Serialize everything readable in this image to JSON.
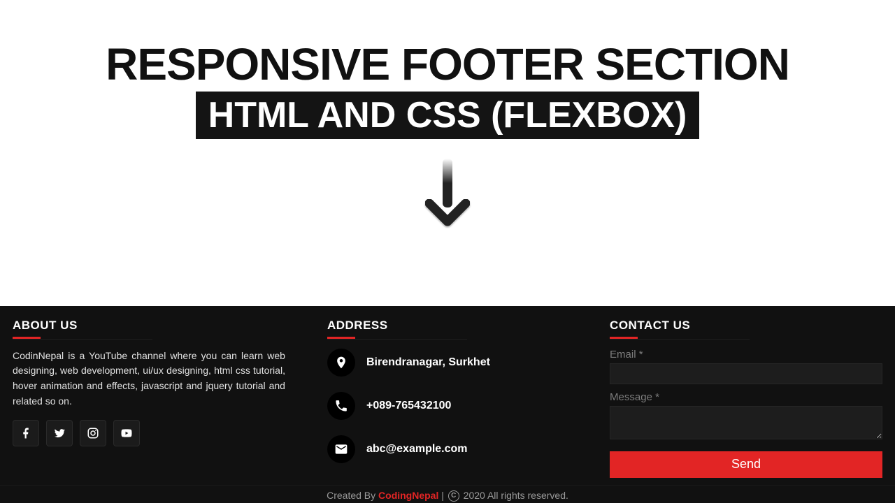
{
  "hero": {
    "title": "RESPONSIVE FOOTER SECTION",
    "subtitle": "HTML AND CSS (FLEXBOX)"
  },
  "footer": {
    "about": {
      "heading": "ABOUT US",
      "text": "CodinNepal is a YouTube channel where you can learn web designing, web development, ui/ux designing, html css tutorial, hover animation and effects, javascript and jquery tutorial and related so on.",
      "socials": [
        {
          "name": "facebook"
        },
        {
          "name": "twitter"
        },
        {
          "name": "instagram"
        },
        {
          "name": "youtube"
        }
      ]
    },
    "address": {
      "heading": "ADDRESS",
      "items": [
        {
          "icon": "location",
          "text": "Birendranagar, Surkhet"
        },
        {
          "icon": "phone",
          "text": "+089-765432100"
        },
        {
          "icon": "email",
          "text": "abc@example.com"
        }
      ]
    },
    "contact": {
      "heading": "CONTACT US",
      "email_label": "Email *",
      "message_label": "Message *",
      "send_label": "Send"
    },
    "credit": {
      "created_by": "Created By ",
      "brand": "CodingNepal",
      "sep": " | ",
      "rights": " 2020 All rights reserved."
    }
  }
}
